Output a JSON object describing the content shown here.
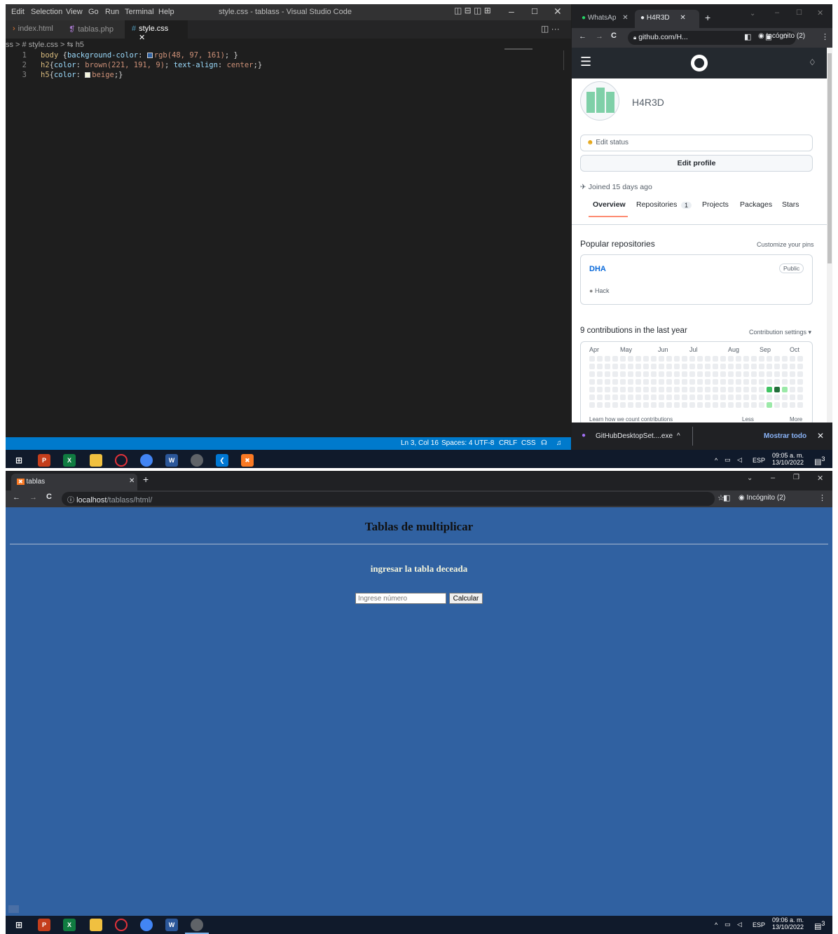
{
  "vscode": {
    "menu": [
      "Edit",
      "Selection",
      "View",
      "Go",
      "Run",
      "Terminal",
      "Help"
    ],
    "title": "style.css - tablass - Visual Studio Code",
    "tabs": [
      {
        "label": "index.html"
      },
      {
        "label": "tablas.php"
      },
      {
        "label": "style.css"
      }
    ],
    "tab_close": "✕",
    "breadcrumb": "ss > # style.css > ⇆ h5",
    "code": [
      {
        "n": "1",
        "sel": "body ",
        "open": "{",
        "prop": "background-color",
        "colon": ": ",
        "val": "rgb(48, 97, 161)",
        "close": "; }",
        "swatch": "#3061a1"
      },
      {
        "n": "2",
        "sel": "h2",
        "open": "{",
        "prop": "color",
        "colon": ": ",
        "val": "brown(221, 191, 9)",
        "mid": "; ",
        "prop2": "text-align",
        "val2": "center",
        "close": ";}"
      },
      {
        "n": "3",
        "sel": "h5",
        "open": "{",
        "prop": "color",
        "colon": ": ",
        "val": "beige",
        "close": ";}",
        "swatch": "#f5f5dc"
      }
    ],
    "status": {
      "pos": "Ln 3, Col 16",
      "spaces": "Spaces: 4",
      "enc": "UTF-8",
      "eol": "CRLF",
      "lang": "CSS"
    }
  },
  "github_window": {
    "tabs": [
      {
        "label": "WhatsAp"
      },
      {
        "label": "H4R3D"
      }
    ],
    "new_tab": "+",
    "url": "github.com/H...",
    "incognito": "Incógnito (2)",
    "username": "H4R3D",
    "edit_status": "Edit status",
    "edit_profile": "Edit profile",
    "joined": "Joined 15 days ago",
    "tabs_nav": [
      {
        "label": "Overview"
      },
      {
        "label": "Repositories"
      },
      {
        "label": "Projects"
      },
      {
        "label": "Packages"
      },
      {
        "label": "Stars"
      }
    ],
    "repo_count": "1",
    "popular": "Popular repositories",
    "customize": "Customize your pins",
    "repo_name": "DHA",
    "repo_visibility": "Public",
    "repo_lang": "Hack",
    "contributions": "9 contributions in the last year",
    "contrib_settings": "Contribution settings ▾",
    "months": [
      "Apr",
      "May",
      "Jun",
      "Jul",
      "Aug",
      "Sep",
      "Oct"
    ],
    "learn": "Learn how we count contributions",
    "less": "Less",
    "more": "More",
    "download_file": "GitHubDesktopSet....exe",
    "show_all": "Mostrar todo"
  },
  "taskbar_top": {
    "lang": "ESP",
    "time": "09:05 a. m.",
    "date": "13/10/2022",
    "notif": "3"
  },
  "browser_bottom": {
    "tab_title": "tablas",
    "url_host": "localhost",
    "url_path": "/tablass/html/",
    "incognito": "Incógnito (2)",
    "heading": "Tablas de multiplicar",
    "subheading": "ingresar la tabla deceada",
    "input_placeholder": "Ingrese número",
    "button": "Calcular"
  },
  "taskbar_bottom": {
    "lang": "ESP",
    "time": "09:06 a. m.",
    "date": "13/10/2022",
    "notif": "3"
  }
}
